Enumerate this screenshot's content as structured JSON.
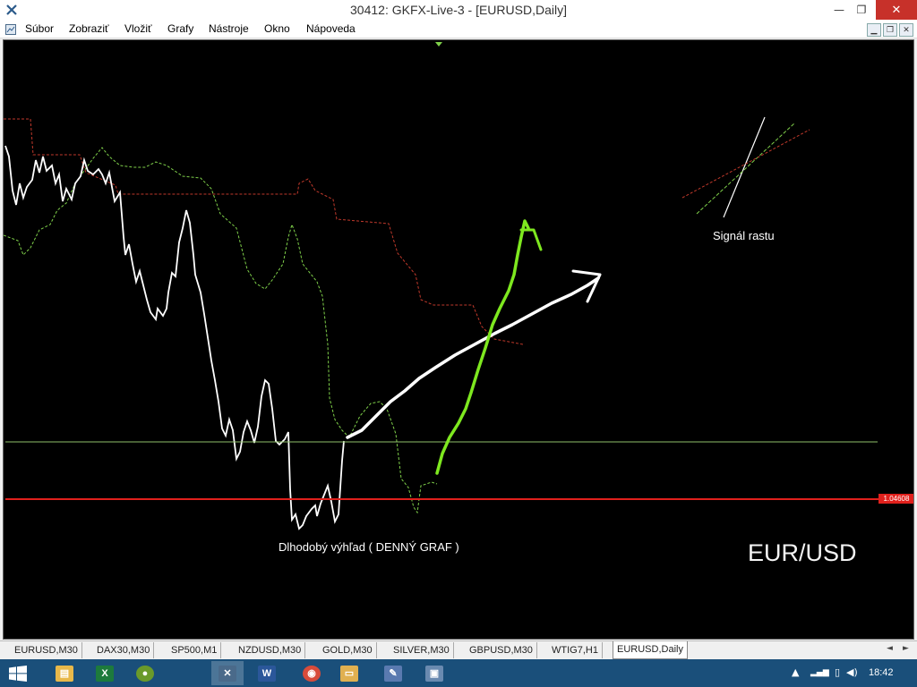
{
  "window": {
    "title": "30412: GKFX-Live-3 - [EURUSD,Daily]",
    "close_glyph": "✕",
    "maximize_glyph": "❐",
    "minimize_glyph": "—"
  },
  "menu": {
    "items": [
      "Súbor",
      "Zobraziť",
      "Vložiť",
      "Grafy",
      "Nástroje",
      "Okno",
      "Nápoveda"
    ]
  },
  "chart": {
    "annotation_signal": "Signál rastu",
    "annotation_outlook": "Dlhodobý výhľad ( DENNÝ GRAF )",
    "symbol_label": "EUR/USD",
    "price_tag": "1.04608",
    "colors": {
      "background": "#000000",
      "price_line": "#ffffff",
      "dashed_green": "#7fd04a",
      "dashed_red": "#c0392b",
      "horizontal_green": "#8fbf6a",
      "support_red": "#e0201c",
      "arrow_green": "#7ee81f",
      "arrow_white": "#ffffff"
    }
  },
  "tabs": {
    "items": [
      "EURUSD,M30",
      "DAX30,M30",
      "SP500,M1",
      "NZDUSD,M30",
      "GOLD,M30",
      "SILVER,M30",
      "GBPUSD,M30",
      "WTIG7,H1",
      "EURUSD,Daily"
    ],
    "active": "EURUSD,Daily",
    "left_arrow": "◄",
    "right_arrow": "►"
  },
  "taskbar": {
    "clock": "18:42",
    "apps": [
      {
        "icon": "file-explorer-icon",
        "glyph": "▤",
        "color": "#e8b84a"
      },
      {
        "icon": "excel-icon",
        "glyph": "X",
        "color": "#1d7a3c"
      },
      {
        "icon": "green-globe-app-icon",
        "glyph": "●",
        "color": "#6a9a2a"
      },
      {
        "icon": "metatrader-icon",
        "glyph": "✕",
        "color": "#4a6a8a"
      },
      {
        "icon": "word-icon",
        "glyph": "W",
        "color": "#2b579a"
      },
      {
        "icon": "chrome-icon",
        "glyph": "◉",
        "color": "#d84b3a"
      },
      {
        "icon": "folder-icon",
        "glyph": "▭",
        "color": "#e0b050"
      },
      {
        "icon": "paint-app-icon",
        "glyph": "✎",
        "color": "#5a7ab0"
      },
      {
        "icon": "metatrader-alt-icon",
        "glyph": "▣",
        "color": "#6a8ab0"
      }
    ],
    "tray_up": "▲",
    "tray_signal": "▂▄▆",
    "tray_battery": "▯",
    "tray_volume": "◀)"
  }
}
